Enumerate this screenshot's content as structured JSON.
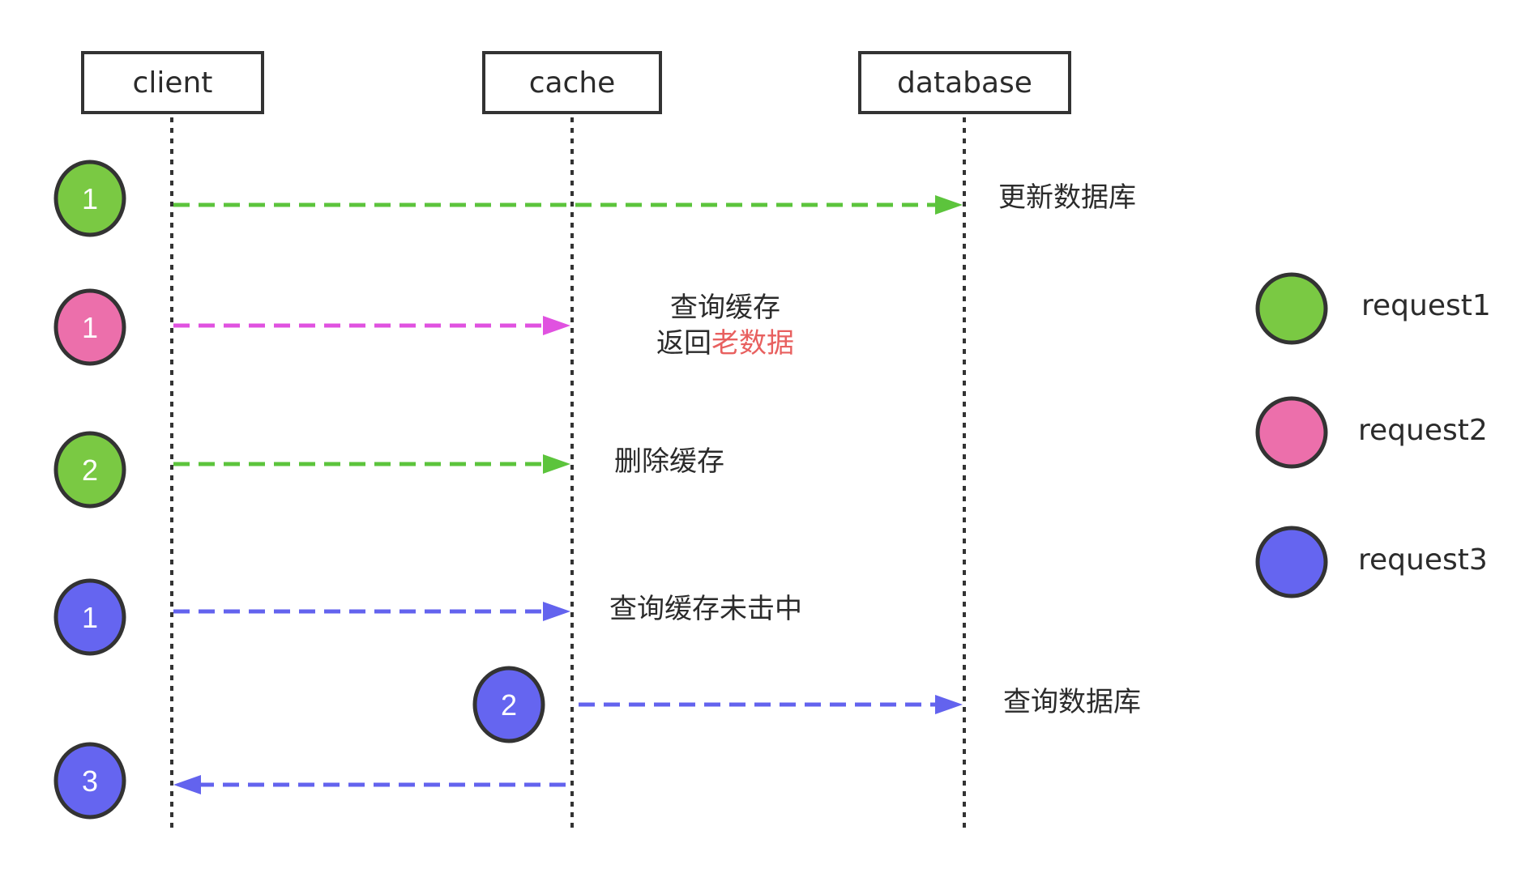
{
  "diagram": {
    "type": "sequence",
    "actors": [
      {
        "id": "client",
        "label": "client"
      },
      {
        "id": "cache",
        "label": "cache"
      },
      {
        "id": "database",
        "label": "database"
      }
    ],
    "colors": {
      "request1": "#7ac943",
      "request2": "#ec6fab",
      "request3": "#6565f0",
      "arrow_request1": "#5cc43c",
      "arrow_request2": "#e052e0",
      "arrow_request3": "#6363ee",
      "stroke": "#333333",
      "highlight_text": "#e8605f"
    },
    "steps": [
      {
        "request": "request1",
        "step": "1",
        "from": "client",
        "to": "database",
        "direction": "right",
        "label": "更新数据库"
      },
      {
        "request": "request2",
        "step": "1",
        "from": "client",
        "to": "cache",
        "direction": "right",
        "label_line1": "查询缓存",
        "label_line2_plain": "返回",
        "label_line2_highlight": "老数据"
      },
      {
        "request": "request1",
        "step": "2",
        "from": "client",
        "to": "cache",
        "direction": "right",
        "label": "删除缓存"
      },
      {
        "request": "request3",
        "step": "1",
        "from": "client",
        "to": "cache",
        "direction": "right",
        "label": "查询缓存未击中"
      },
      {
        "request": "request3",
        "step": "2",
        "from": "cache",
        "to": "database",
        "direction": "right",
        "label": "查询数据库"
      },
      {
        "request": "request3",
        "step": "3",
        "from": "cache",
        "to": "client",
        "direction": "left",
        "label": ""
      }
    ],
    "legend": [
      {
        "key": "request1",
        "label": "request1"
      },
      {
        "key": "request2",
        "label": "request2"
      },
      {
        "key": "request3",
        "label": "request3"
      }
    ]
  }
}
